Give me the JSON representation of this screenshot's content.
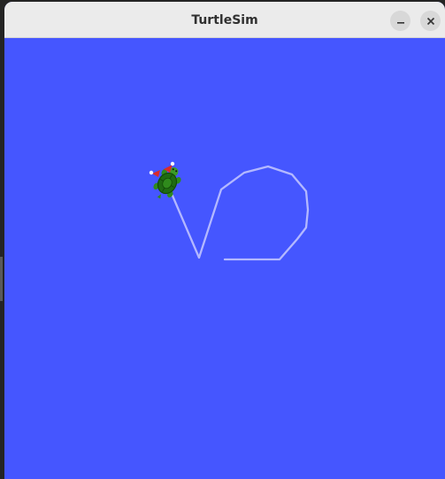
{
  "window": {
    "title": "TurtleSim",
    "background_color": "#4556ff",
    "pen_color": "#b3b8ff",
    "minimize_icon": "minimize-icon",
    "close_icon": "close-icon"
  }
}
